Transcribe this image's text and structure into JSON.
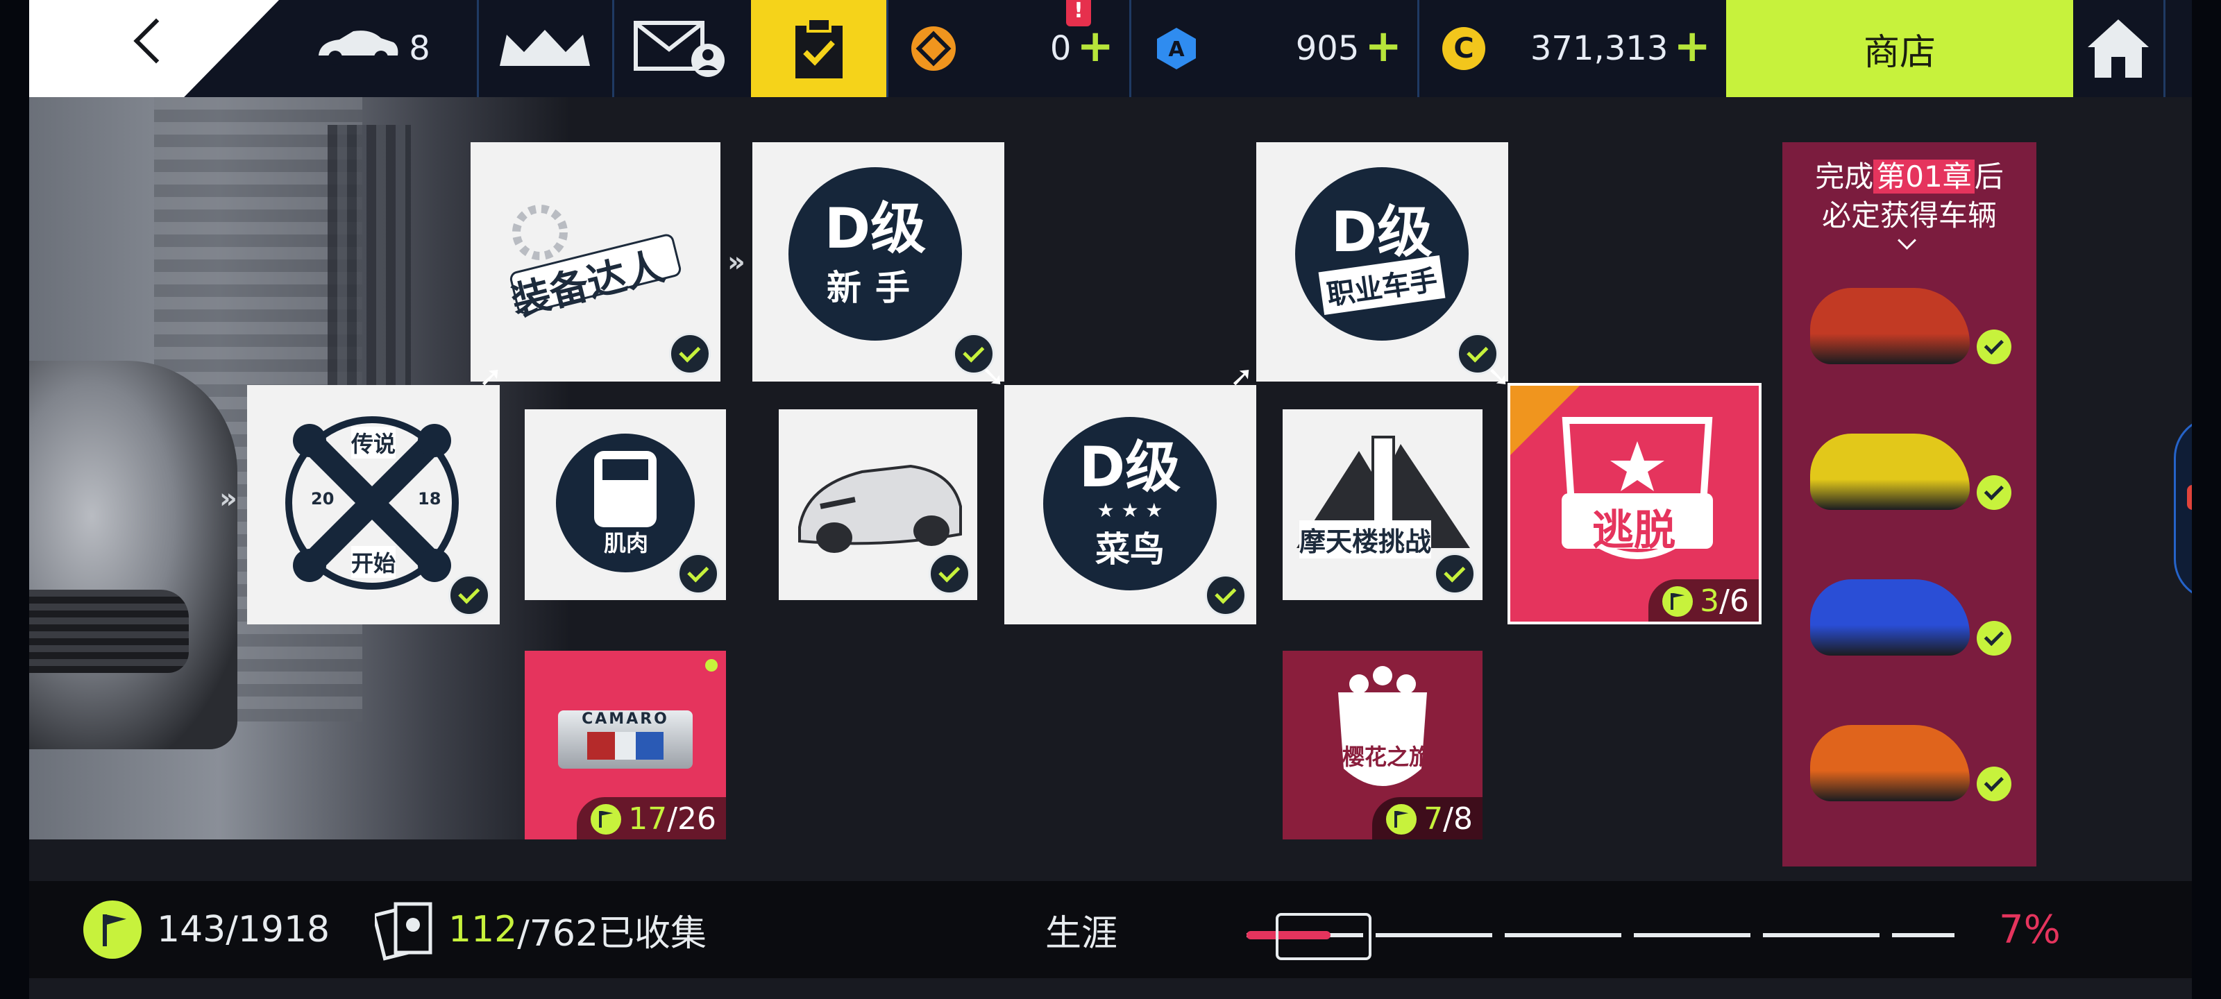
{
  "topbar": {
    "cars_count": "8",
    "currency_tokens": "0",
    "currency_blueprints": "905",
    "currency_credits": "371,313",
    "alert_mark": "!",
    "shop_label": "商店"
  },
  "tiles": {
    "gear_master": "装备达人",
    "rookie_d": "D级",
    "rookie_d_sub": "新手",
    "legend_top": "传说",
    "legend_bottom": "开始",
    "legend_year_left": "20",
    "legend_year_right": "18",
    "muscle": "肌肉",
    "d_rookie": "D级",
    "d_rookie_sub": "菜鸟",
    "skyscraper": "摩天楼挑战",
    "pro_d": "D级",
    "pro_sub": "职业车手",
    "escape": "逃脱",
    "escape_progress_done": "3",
    "escape_progress_total": "/6",
    "camaro": "CAMARO",
    "camaro_progress_done": "17",
    "camaro_progress_total": "/26",
    "sakura": "樱花之旅",
    "sakura_progress_done": "7",
    "sakura_progress_total": "/8"
  },
  "reward": {
    "line1_pre": "完成",
    "line1_hl": "第01章",
    "line1_post": "后",
    "line2": "必定获得车辆",
    "cars": [
      {
        "color": "#c23a24",
        "name": "red-roadster"
      },
      {
        "color": "#e2c81a",
        "name": "yellow-coupe"
      },
      {
        "color": "#2a4ed6",
        "name": "blue-supercar"
      },
      {
        "color": "#e0641c",
        "name": "orange-muscle"
      }
    ]
  },
  "bottombar": {
    "flags": "143/1918",
    "collected_count": "112",
    "collected_total": "/762已收集",
    "career_label": "生涯",
    "career_percent": "7%",
    "career_progress": 0.07
  },
  "colors": {
    "accent_green": "#c7f23c",
    "accent_pink": "#e5345d",
    "active_tab": "#f5d31a",
    "maroon": "#8a1e3c"
  }
}
